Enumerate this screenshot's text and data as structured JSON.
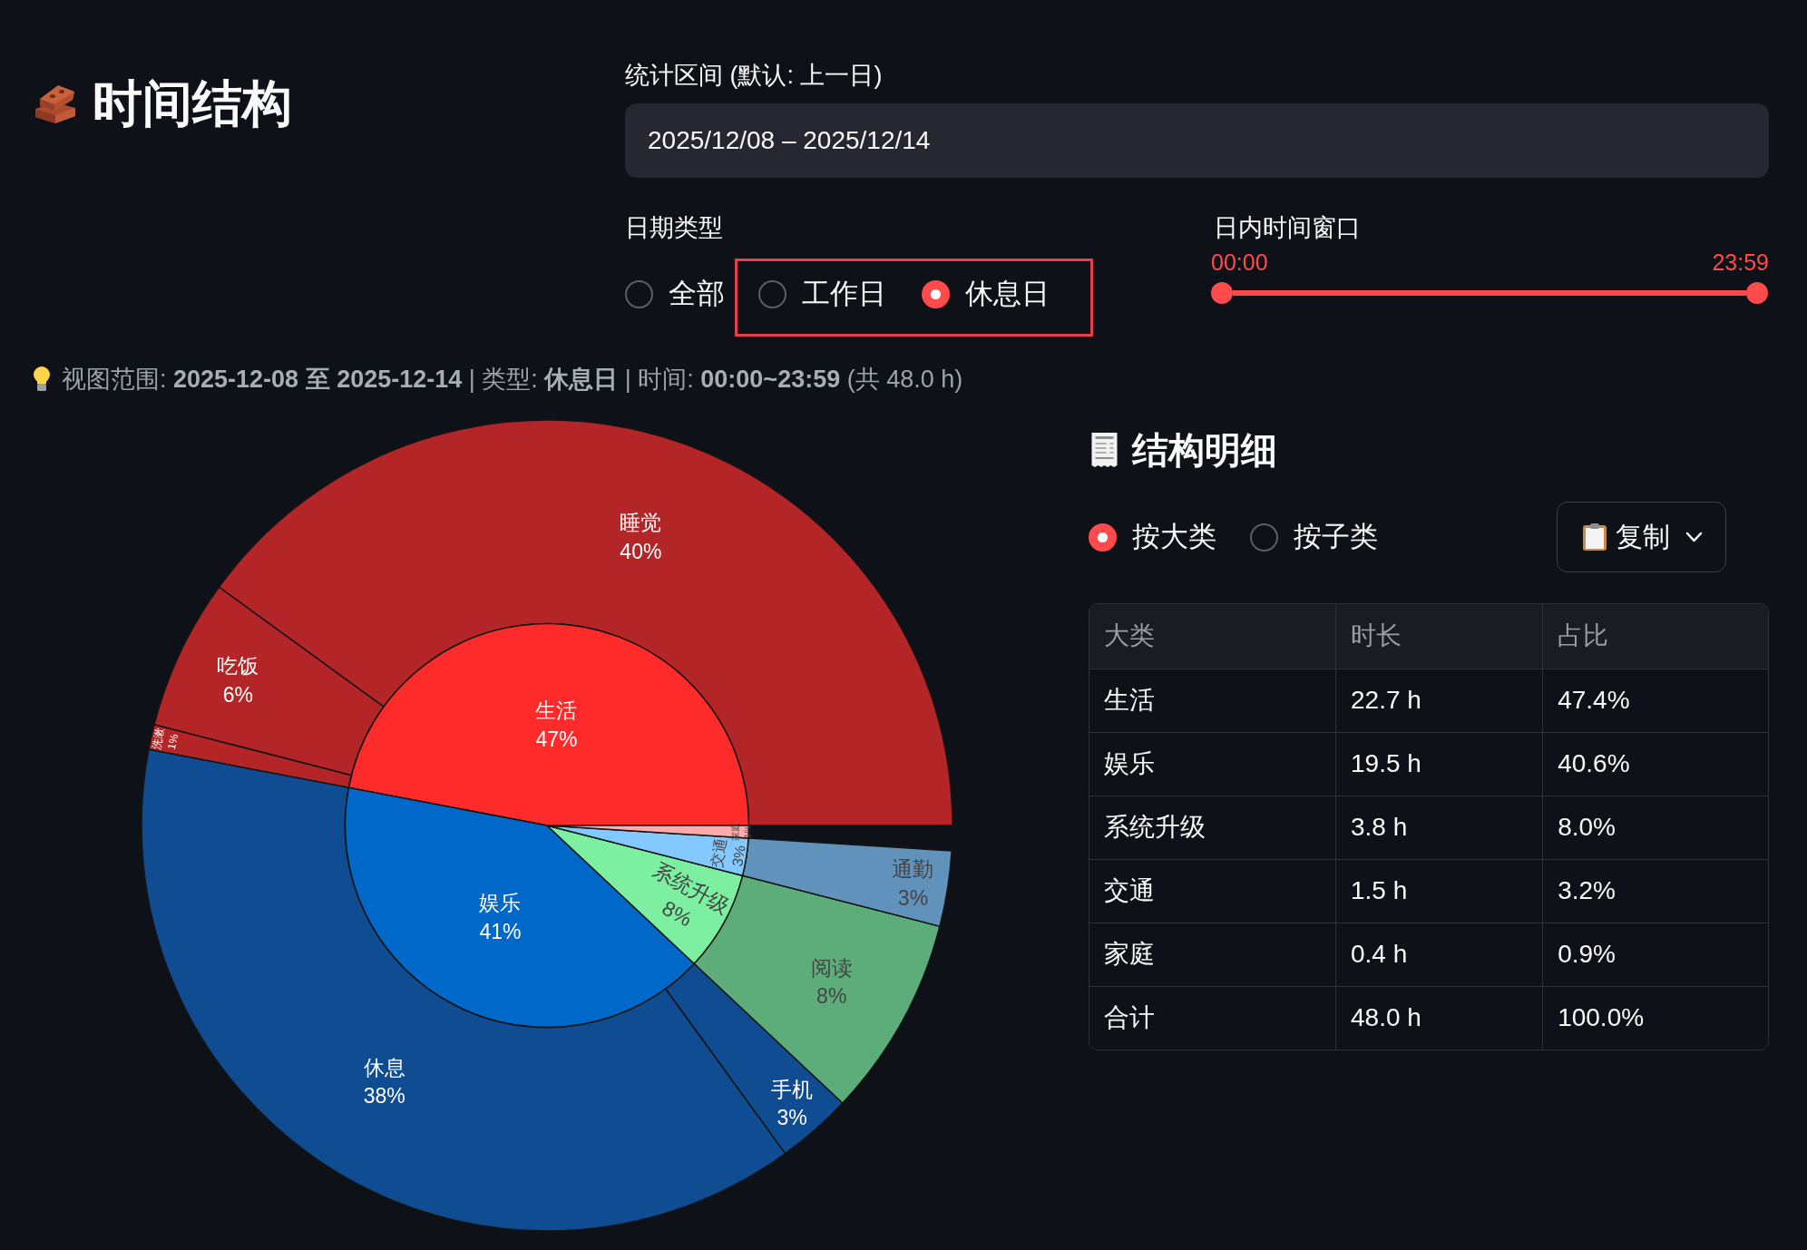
{
  "title": "时间结构",
  "date_range": {
    "label": "统计区间 (默认: 上一日)",
    "value": "2025/12/08 – 2025/12/14"
  },
  "date_type": {
    "label": "日期类型",
    "options": [
      {
        "label": "全部",
        "selected": false,
        "highlighted": false
      },
      {
        "label": "工作日",
        "selected": false,
        "highlighted": true
      },
      {
        "label": "休息日",
        "selected": true,
        "highlighted": true
      }
    ]
  },
  "time_window": {
    "label": "日内时间窗口",
    "handles": [
      {
        "reading": "00:00",
        "level": 0
      },
      {
        "reading": "23:59",
        "level": 1
      }
    ]
  },
  "info": {
    "text": "视图范围: **2025-12-08 至 2025-12-14** | 类型: **休息日** | 时间: **00:00~23:59** (共 48.0 h)"
  },
  "sunburst": {
    "inner_ring": {
      "slices": [
        {
          "color": "#ff2b2b"
        },
        {
          "color": "#0068c9"
        },
        {
          "color": "#7defa1"
        },
        {
          "color": "#83c9ff"
        },
        {
          "color": "#ffabab"
        }
      ],
      "chart_data": {
        "type": "pie",
        "categories": [
          "生活",
          "娱乐",
          "系统升级",
          "交通",
          "家庭"
        ],
        "values": [
          47,
          41,
          8,
          3,
          1
        ],
        "value_labels": [
          "47%",
          "41%",
          "8%",
          "3%",
          "1%"
        ]
      }
    },
    "outer_ring": {
      "slices": [
        {
          "color": "#b42527"
        },
        {
          "color": "#b42527"
        },
        {
          "color": "#b42527"
        },
        {
          "color": "#0f4c92"
        },
        {
          "color": "#0f4c92"
        },
        {
          "color": "#5cad7a"
        },
        {
          "color": "#6092bc"
        }
      ],
      "chart_data": {
        "type": "donut",
        "categories": [
          "睡觉",
          "吃饭",
          "洗漱",
          "休息",
          "手机",
          "阅读",
          "通勤"
        ],
        "values": [
          40,
          6,
          1,
          38,
          3,
          8,
          3
        ],
        "value_labels": [
          "40%",
          "6%",
          "1%",
          "38%",
          "3%",
          "8%",
          "3%"
        ]
      }
    }
  },
  "detail": {
    "title": "结构明细",
    "group_by": [
      {
        "label": "按大类",
        "selected": true
      },
      {
        "label": "按子类",
        "selected": false
      }
    ],
    "copy_button": {
      "label": "复制"
    },
    "table": {
      "columns": [
        "大类",
        "时长",
        "占比"
      ],
      "rows": [
        [
          "生活",
          "22.7 h",
          "47.4%"
        ],
        [
          "娱乐",
          "19.5 h",
          "40.6%"
        ],
        [
          "系统升级",
          "3.8 h",
          "8.0%"
        ],
        [
          "交通",
          "1.5 h",
          "3.2%"
        ],
        [
          "家庭",
          "0.4 h",
          "0.9%"
        ],
        [
          "合计",
          "48.0 h",
          "100.0%"
        ]
      ]
    }
  }
}
